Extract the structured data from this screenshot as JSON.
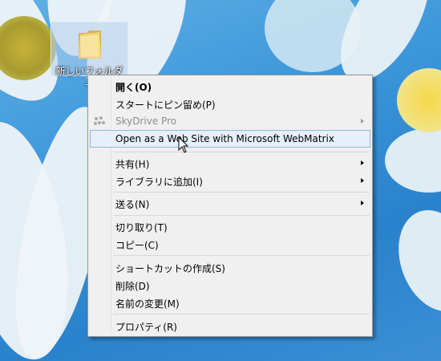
{
  "desktop": {
    "folder_label": "新しいフォルダー"
  },
  "context_menu": {
    "items": [
      {
        "label": "開く(O)",
        "bold": true
      },
      {
        "label": "スタートにピン留め(P)"
      },
      {
        "label": "SkyDrive Pro",
        "disabled": true,
        "submenu": true,
        "icon": "skydrive-pro-icon"
      },
      {
        "label": "Open as a Web Site with Microsoft WebMatrix",
        "highlighted": true
      },
      {
        "label": "共有(H)",
        "submenu": true
      },
      {
        "label": "ライブラリに追加(I)",
        "submenu": true
      },
      {
        "label": "送る(N)",
        "submenu": true
      },
      {
        "label": "切り取り(T)"
      },
      {
        "label": "コピー(C)"
      },
      {
        "label": "ショートカットの作成(S)"
      },
      {
        "label": "削除(D)"
      },
      {
        "label": "名前の変更(M)"
      },
      {
        "label": "プロパティ(R)"
      }
    ]
  },
  "colors": {
    "menu_background": "#f0f0f0",
    "highlight_background": "#e5f0fb",
    "highlight_border": "#8fb8e8",
    "desktop_blue": "#3b95d8"
  }
}
